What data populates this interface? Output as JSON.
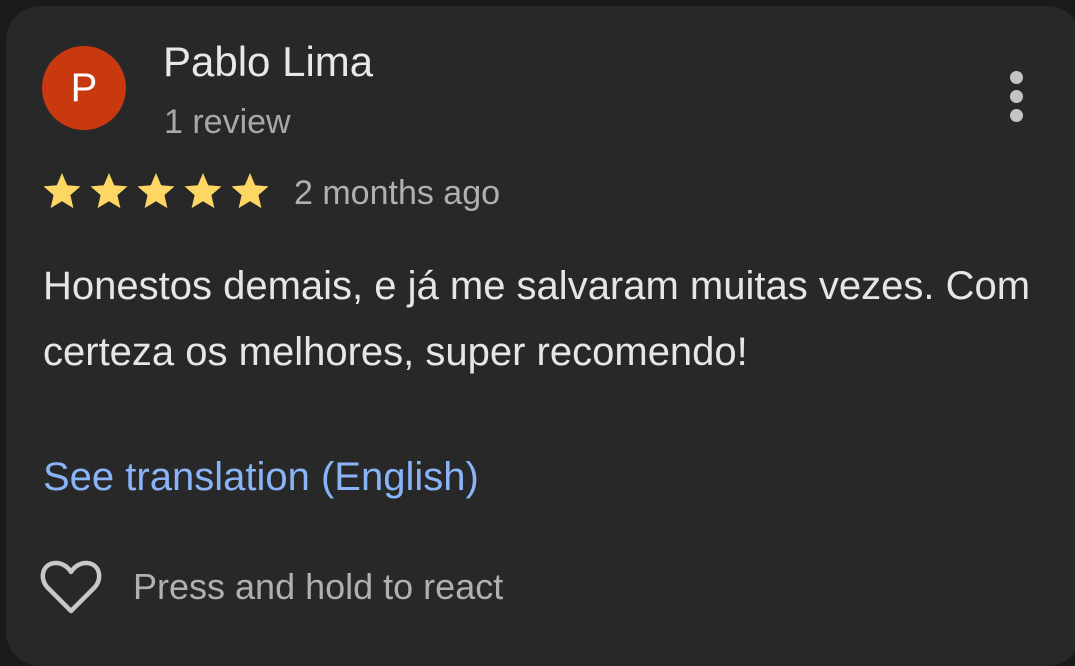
{
  "review": {
    "author": {
      "initial": "P",
      "name": "Pablo Lima",
      "review_count": "1 review",
      "avatar_color": "#c8390f"
    },
    "rating": 5,
    "max_rating": 5,
    "star_color": "#fdd663",
    "time_ago": "2 months ago",
    "text": "Honestos demais, e já me salvaram muitas vezes. Com certeza os melhores, super recomendo!",
    "translation_link": "See translation (English)",
    "react_label": "Press and hold to react",
    "icons": {
      "more": "more-vert-icon",
      "react": "heart-outline-icon",
      "star": "star-icon"
    }
  }
}
